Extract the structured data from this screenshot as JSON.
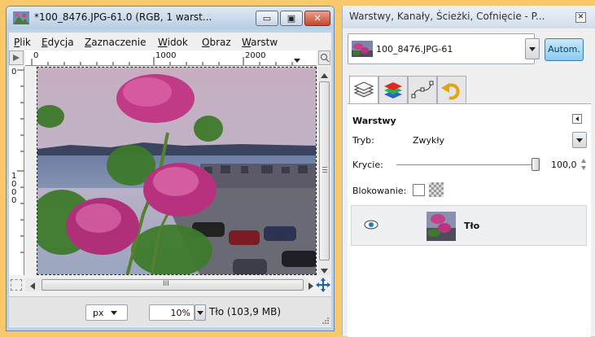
{
  "image_window": {
    "title": "*100_8476.JPG-61.0 (RGB, 1 warst...",
    "menu": [
      {
        "label": "Plik",
        "mnemonic": "P"
      },
      {
        "label": "Edycja",
        "mnemonic": "E"
      },
      {
        "label": "Zaznaczenie",
        "mnemonic": "Z"
      },
      {
        "label": "Widok",
        "mnemonic": "W"
      },
      {
        "label": "Obraz",
        "mnemonic": "O"
      },
      {
        "label": "Warstw",
        "mnemonic": "W"
      }
    ],
    "ruler_h_ticks": [
      "0",
      "1000",
      "2000"
    ],
    "ruler_v_ticks": [
      "0",
      "1000"
    ],
    "status": {
      "unit": "px",
      "zoom": "10%",
      "info": "Tło (103,9 MB)"
    },
    "hscroll_grip": "III"
  },
  "dock": {
    "title": "Warstwy, Kanały, Ścieżki, Cofnięcie - P...",
    "image_selector": "100_8476.JPG-61",
    "auto_button": "Autom.",
    "tabs": [
      "layers",
      "channels",
      "paths",
      "undo"
    ],
    "layers_panel": {
      "heading": "Warstwy",
      "mode_label": "Tryb:",
      "mode_value": "Zwykły",
      "opacity_label": "Krycie:",
      "opacity_value": "100,0",
      "opacity_fraction": 1.0,
      "lock_label": "Blokowanie:",
      "layers": [
        {
          "name": "Tło",
          "visible": true
        }
      ]
    }
  },
  "colors": {
    "background": "#f7c96b",
    "title_blue": "#bcd3ea",
    "close_red": "#c8452b",
    "auto_btn": "#9ad0f0"
  }
}
